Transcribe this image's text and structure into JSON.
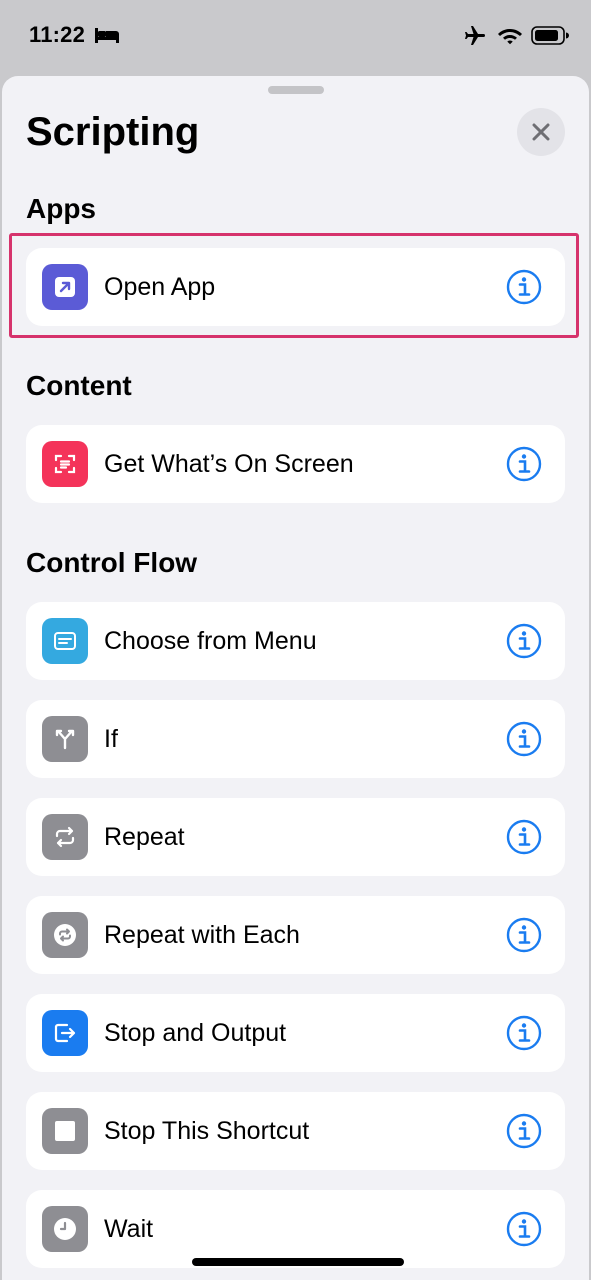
{
  "status_bar": {
    "time": "11:22",
    "icons": [
      "bed-icon",
      "airplane-icon",
      "wifi-icon",
      "battery-icon"
    ]
  },
  "sheet": {
    "title": "Scripting",
    "close_icon": "close-icon"
  },
  "sections": {
    "apps": {
      "header": "Apps",
      "items": [
        {
          "label": "Open App",
          "icon": "open-app-icon",
          "color": "#5b5bd6"
        }
      ]
    },
    "content": {
      "header": "Content",
      "items": [
        {
          "label": "Get What’s On Screen",
          "icon": "screen-scan-icon",
          "color": "#f4335a"
        }
      ]
    },
    "control_flow": {
      "header": "Control Flow",
      "items": [
        {
          "label": "Choose from Menu",
          "icon": "menu-icon",
          "color": "#34a9e0"
        },
        {
          "label": "If",
          "icon": "branch-icon",
          "color": "#8e8e93"
        },
        {
          "label": "Repeat",
          "icon": "repeat-icon",
          "color": "#8e8e93"
        },
        {
          "label": "Repeat with Each",
          "icon": "repeat-each-icon",
          "color": "#8e8e93"
        },
        {
          "label": "Stop and Output",
          "icon": "stop-output-icon",
          "color": "#1a7cf0"
        },
        {
          "label": "Stop This Shortcut",
          "icon": "stop-icon",
          "color": "#8e8e93"
        },
        {
          "label": "Wait",
          "icon": "clock-icon",
          "color": "#8e8e93"
        }
      ]
    }
  },
  "colors": {
    "accent": "#1a7cf0",
    "highlight": "#d6336c",
    "sheet_background": "#f2f2f6",
    "row_background": "#ffffff"
  }
}
